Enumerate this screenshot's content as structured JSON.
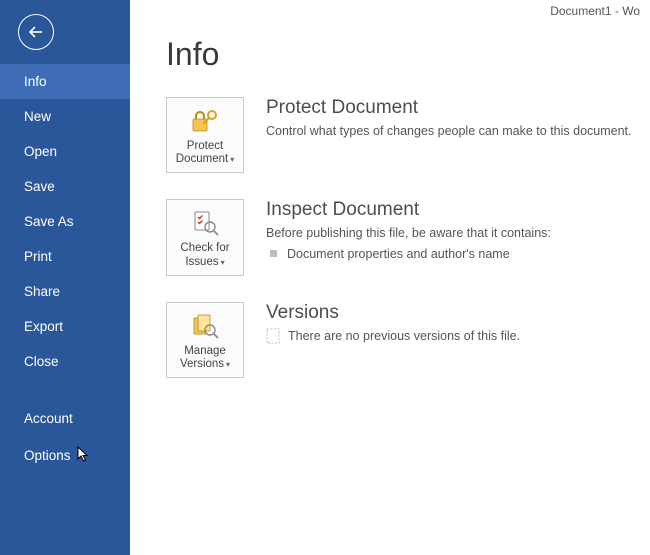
{
  "titlebar": "Document1 - Wo",
  "sidebar": {
    "items": [
      {
        "label": "Info",
        "active": true
      },
      {
        "label": "New"
      },
      {
        "label": "Open"
      },
      {
        "label": "Save"
      },
      {
        "label": "Save As"
      },
      {
        "label": "Print"
      },
      {
        "label": "Share"
      },
      {
        "label": "Export"
      },
      {
        "label": "Close"
      }
    ],
    "footer": [
      {
        "label": "Account"
      },
      {
        "label": "Options"
      }
    ]
  },
  "page": {
    "title": "Info",
    "sections": {
      "protect": {
        "tile_label": "Protect Document",
        "heading": "Protect Document",
        "desc": "Control what types of changes people can make to this document."
      },
      "inspect": {
        "tile_label": "Check for Issues",
        "heading": "Inspect Document",
        "desc": "Before publishing this file, be aware that it contains:",
        "bullet": "Document properties and author's name"
      },
      "versions": {
        "tile_label": "Manage Versions",
        "heading": "Versions",
        "desc": "There are no previous versions of this file."
      }
    }
  }
}
